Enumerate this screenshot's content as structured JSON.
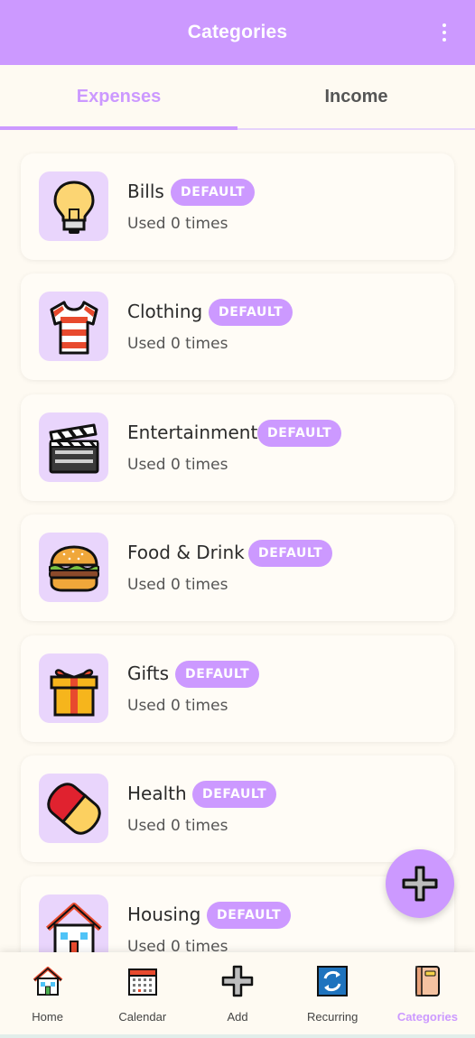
{
  "appbar": {
    "title": "Categories",
    "menu_icon": "more-vert-icon"
  },
  "tabs": [
    {
      "label": "Expenses",
      "active": true
    },
    {
      "label": "Income",
      "active": false
    }
  ],
  "categories": [
    {
      "name": "Bills",
      "badge": "DEFAULT",
      "usage": "Used 0 times",
      "icon": "lightbulb-icon"
    },
    {
      "name": "Clothing",
      "badge": "DEFAULT",
      "usage": "Used 0 times",
      "icon": "tshirt-icon"
    },
    {
      "name": "Entertainment",
      "badge": "DEFAULT",
      "usage": "Used 0 times",
      "icon": "clapperboard-icon"
    },
    {
      "name": "Food & Drink",
      "badge": "DEFAULT",
      "usage": "Used 0 times",
      "icon": "burger-icon"
    },
    {
      "name": "Gifts",
      "badge": "DEFAULT",
      "usage": "Used 0 times",
      "icon": "gift-icon"
    },
    {
      "name": "Health",
      "badge": "DEFAULT",
      "usage": "Used 0 times",
      "icon": "pill-icon"
    },
    {
      "name": "Housing",
      "badge": "DEFAULT",
      "usage": "Used 0 times",
      "icon": "house-icon"
    }
  ],
  "fab": {
    "icon": "plus-icon"
  },
  "bottom_nav": [
    {
      "label": "Home",
      "icon": "house-icon",
      "active": false
    },
    {
      "label": "Calendar",
      "icon": "calendar-icon",
      "active": false
    },
    {
      "label": "Add",
      "icon": "plus-icon",
      "active": false
    },
    {
      "label": "Recurring",
      "icon": "repeat-icon",
      "active": false
    },
    {
      "label": "Categories",
      "icon": "notebook-icon",
      "active": true
    }
  ],
  "colors": {
    "accent": "#cc99ff",
    "background": "#fefaf2",
    "icon_tile": "#e9d5fc"
  }
}
